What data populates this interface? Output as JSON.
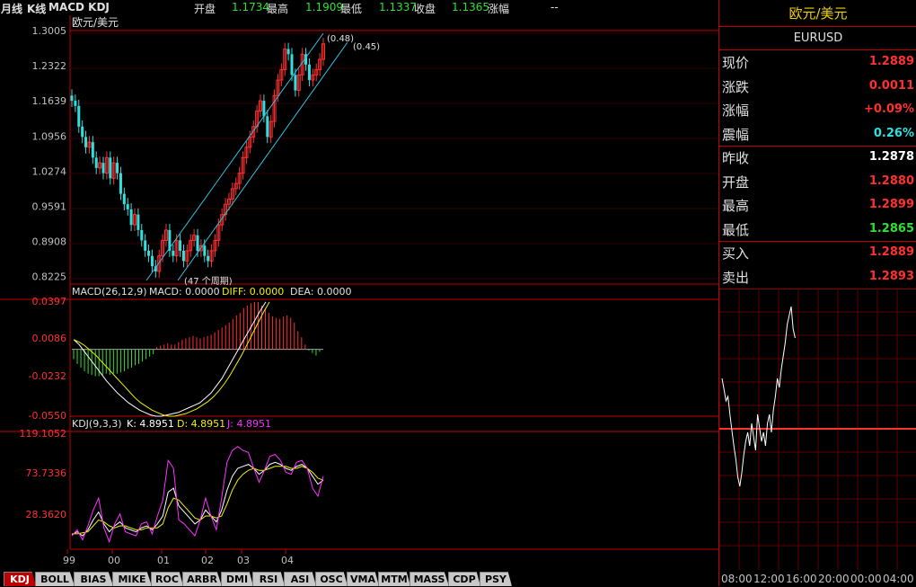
{
  "header": {
    "period": "月线",
    "kline": "K线",
    "indicators": "MACD KDJ",
    "open_label": "开盘",
    "open_value": "1.1734",
    "high_label": "最高",
    "high_value": "1.1909",
    "low_label": "最低",
    "low_value": "1.1337",
    "close_label": "收盘",
    "close_value": "1.1365",
    "change_label": "涨幅",
    "change_value": "--"
  },
  "main_panel": {
    "symbol_label": "欧元/美元",
    "y_ticks": [
      "1.3005",
      "1.2322",
      "1.1639",
      "1.0956",
      "1.0274",
      "0.9591",
      "0.8908",
      "0.8225"
    ],
    "channel_labels": [
      "(0.48)",
      "(0.45)",
      "(47 个周期)"
    ]
  },
  "macd_panel": {
    "title": "MACD(26,12,9)",
    "macd_label": "MACD: 0.0000",
    "diff_label": "DIFF: 0.0000",
    "dea_label": "DEA: 0.0000",
    "y_ticks": [
      "0.0397",
      "0.0086",
      "-0.0232",
      "-0.0550"
    ]
  },
  "kdj_panel": {
    "title": "KDJ(9,3,3)",
    "k_label": "K: 4.8951",
    "d_label": "D: 4.8951",
    "j_label": "J: 4.8951",
    "y_ticks": [
      "119.1052",
      "73.7336",
      "28.3620"
    ]
  },
  "x_axis": [
    "99",
    "00",
    "01",
    "02",
    "03",
    "04"
  ],
  "tabs": [
    "KDJ",
    "BOLL",
    "BIAS",
    "MIKE",
    "ROC",
    "ARBR",
    "DMI",
    "RSI",
    "ASI",
    "OSC",
    "VMA",
    "MTM",
    "MASS",
    "CDP",
    "PSY"
  ],
  "active_tab": "KDJ",
  "quote_panel": {
    "title": "欧元/美元",
    "code": "EURUSD",
    "rows": [
      {
        "label": "现价",
        "value": "1.2889",
        "color": "#ff3030"
      },
      {
        "label": "涨跌",
        "value": "0.0011",
        "color": "#ff3030"
      },
      {
        "label": "涨幅",
        "value": "+0.09%",
        "color": "#ff3030"
      },
      {
        "label": "震幅",
        "value": "0.26%",
        "color": "#30e0e0"
      },
      {
        "label": "昨收",
        "value": "1.2878",
        "color": "#ffffff"
      },
      {
        "label": "开盘",
        "value": "1.2880",
        "color": "#ff3030"
      },
      {
        "label": "最高",
        "value": "1.2899",
        "color": "#ff3030"
      },
      {
        "label": "最低",
        "value": "1.2865",
        "color": "#30e030"
      },
      {
        "label": "买入",
        "value": "1.2889",
        "color": "#ff3030"
      },
      {
        "label": "卖出",
        "value": "1.2893",
        "color": "#ff3030"
      }
    ],
    "time_axis": [
      "08:00",
      "12:00",
      "16:00",
      "20:00",
      "00:00",
      "04:00"
    ]
  },
  "chart_data": [
    {
      "type": "candlestick",
      "title": "欧元/美元",
      "ylim": [
        0.8225,
        1.3005
      ],
      "x_ticks": [
        "99",
        "00",
        "01",
        "02",
        "03",
        "04"
      ],
      "close": [
        1.17,
        1.16,
        1.12,
        1.1,
        1.08,
        1.09,
        1.06,
        1.04,
        1.05,
        1.03,
        1.06,
        1.02,
        1.05,
        1.03,
        0.99,
        0.97,
        0.96,
        0.93,
        0.95,
        0.92,
        0.9,
        0.88,
        0.87,
        0.85,
        0.84,
        0.87,
        0.9,
        0.92,
        0.88,
        0.87,
        0.9,
        0.88,
        0.86,
        0.88,
        0.9,
        0.91,
        0.88,
        0.89,
        0.87,
        0.86,
        0.88,
        0.9,
        0.93,
        0.95,
        0.97,
        0.98,
        1.0,
        1.01,
        1.03,
        1.06,
        1.08,
        1.1,
        1.12,
        1.15,
        1.17,
        1.14,
        1.1,
        1.13,
        1.18,
        1.21,
        1.23,
        1.27,
        1.26,
        1.22,
        1.19,
        1.22,
        1.26,
        1.24,
        1.21,
        1.22,
        1.23,
        1.25,
        1.28
      ],
      "channel_slopes": [
        "0.48",
        "0.45"
      ],
      "channel_period": "47 个周期"
    },
    {
      "type": "bar",
      "title": "MACD(26,12,9)",
      "ylim": [
        -0.055,
        0.0397
      ],
      "histogram": [
        -0.008,
        -0.012,
        -0.015,
        -0.018,
        -0.02,
        -0.021,
        -0.022,
        -0.022,
        -0.021,
        -0.02,
        -0.021,
        -0.02,
        -0.02,
        -0.019,
        -0.018,
        -0.016,
        -0.015,
        -0.013,
        -0.012,
        -0.01,
        -0.008,
        -0.006,
        -0.004,
        0.002,
        0.003,
        0.004,
        0.005,
        0.004,
        0.004,
        0.006,
        0.008,
        0.009,
        0.01,
        0.011,
        0.01,
        0.009,
        0.01,
        0.011,
        0.012,
        0.014,
        0.016,
        0.018,
        0.02,
        0.022,
        0.025,
        0.028,
        0.03,
        0.034,
        0.036,
        0.038,
        0.039,
        0.039,
        0.036,
        0.034,
        0.03,
        0.027,
        0.026,
        0.025,
        0.027,
        0.028,
        0.026,
        0.022,
        0.015,
        0.01,
        0.004,
        -0.001,
        -0.003,
        -0.005,
        -0.002
      ],
      "diff": [
        0.008,
        0.004,
        -0.002,
        -0.008,
        -0.014,
        -0.02,
        -0.026,
        -0.031,
        -0.036,
        -0.04,
        -0.044,
        -0.047,
        -0.05,
        -0.052,
        -0.054,
        -0.055,
        -0.055,
        -0.054,
        -0.053,
        -0.052,
        -0.05,
        -0.048,
        -0.046,
        -0.044,
        -0.04,
        -0.036,
        -0.03,
        -0.024,
        -0.016,
        -0.008,
        0.0,
        0.008,
        0.016,
        0.024,
        0.032,
        0.039
      ],
      "dea": [
        0.008,
        0.006,
        0.003,
        -0.001,
        -0.005,
        -0.01,
        -0.015,
        -0.02,
        -0.025,
        -0.03,
        -0.035,
        -0.04,
        -0.044,
        -0.047,
        -0.05,
        -0.052,
        -0.054,
        -0.055,
        -0.055,
        -0.054,
        -0.053,
        -0.051,
        -0.049,
        -0.046,
        -0.043,
        -0.039,
        -0.034,
        -0.028,
        -0.021,
        -0.013,
        -0.005,
        0.004,
        0.013,
        0.022,
        0.031,
        0.039
      ]
    },
    {
      "type": "line",
      "title": "KDJ(9,3,3)",
      "ylim": [
        5,
        119.1052
      ],
      "series": [
        {
          "name": "K",
          "color": "#ffffff",
          "values": [
            15,
            18,
            14,
            20,
            30,
            38,
            26,
            18,
            24,
            28,
            22,
            20,
            18,
            22,
            24,
            20,
            26,
            34,
            58,
            62,
            44,
            38,
            32,
            26,
            30,
            40,
            34,
            28,
            40,
            60,
            74,
            82,
            84,
            86,
            82,
            76,
            80,
            86,
            88,
            86,
            82,
            80,
            84,
            86,
            82,
            74,
            66,
            70
          ]
        },
        {
          "name": "D",
          "color": "#f0f000",
          "values": [
            16,
            16,
            17,
            18,
            24,
            30,
            28,
            24,
            22,
            24,
            24,
            22,
            20,
            20,
            22,
            22,
            22,
            26,
            42,
            52,
            50,
            44,
            38,
            32,
            30,
            34,
            34,
            32,
            34,
            46,
            60,
            70,
            76,
            80,
            82,
            80,
            80,
            82,
            84,
            84,
            84,
            82,
            82,
            84,
            82,
            78,
            72,
            70
          ]
        },
        {
          "name": "J",
          "color": "#ff30ff",
          "values": [
            14,
            20,
            10,
            24,
            40,
            52,
            22,
            8,
            26,
            36,
            18,
            16,
            14,
            26,
            28,
            16,
            34,
            50,
            90,
            82,
            30,
            26,
            20,
            14,
            30,
            52,
            34,
            20,
            52,
            88,
            100,
            104,
            100,
            98,
            82,
            68,
            80,
            94,
            96,
            90,
            78,
            76,
            88,
            90,
            82,
            62,
            54,
            74
          ]
        }
      ]
    }
  ]
}
